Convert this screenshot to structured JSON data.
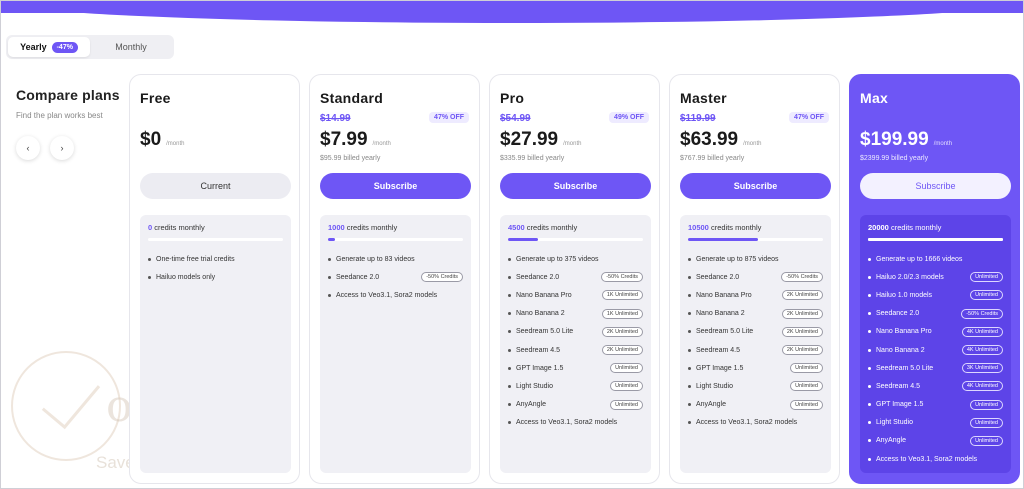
{
  "billing": {
    "yearly_label": "Yearly",
    "yearly_badge": "-47%",
    "monthly_label": "Monthly"
  },
  "side": {
    "title": "Compare plans",
    "subtitle": "Find the plan works best",
    "prev_glyph": "‹",
    "next_glyph": "›"
  },
  "watermark": {
    "brand": "oupon",
    "slogan": "Save time - Save money"
  },
  "colors": {
    "accent": "#6e56f5",
    "muted_bg": "#f0f0f5"
  },
  "plans": [
    {
      "name": "Free",
      "old_price": "",
      "discount": "",
      "price": "$0",
      "per": "/month",
      "billed": "",
      "cta": "Current",
      "credits_value": "0",
      "credits_label": "credits monthly",
      "credits_fill": 0,
      "features": [
        {
          "label": "One-time free trial credits",
          "tag": ""
        },
        {
          "label": "Hailuo models only",
          "tag": ""
        }
      ]
    },
    {
      "name": "Standard",
      "old_price": "$14.99",
      "discount": "47% OFF",
      "price": "$7.99",
      "per": "/month",
      "billed": "$95.99 billed yearly",
      "cta": "Subscribe",
      "credits_value": "1000",
      "credits_label": "credits monthly",
      "credits_fill": 0.05,
      "features": [
        {
          "label": "Generate up to 83 videos",
          "tag": ""
        },
        {
          "label": "Seedance 2.0",
          "tag": "-50% Credits"
        },
        {
          "label": "Access to Veo3.1, Sora2 models",
          "tag": ""
        }
      ]
    },
    {
      "name": "Pro",
      "old_price": "$54.99",
      "discount": "49% OFF",
      "price": "$27.99",
      "per": "/month",
      "billed": "$335.99 billed yearly",
      "cta": "Subscribe",
      "credits_value": "4500",
      "credits_label": "credits monthly",
      "credits_fill": 0.22,
      "features": [
        {
          "label": "Generate up to 375 videos",
          "tag": ""
        },
        {
          "label": "Seedance 2.0",
          "tag": "-50% Credits"
        },
        {
          "label": "Nano Banana Pro",
          "tag": "1K Unlimited"
        },
        {
          "label": "Nano Banana 2",
          "tag": "1K Unlimited"
        },
        {
          "label": "Seedream 5.0 Lite",
          "tag": "2K Unlimited"
        },
        {
          "label": "Seedream 4.5",
          "tag": "2K Unlimited"
        },
        {
          "label": "GPT Image 1.5",
          "tag": "Unlimited"
        },
        {
          "label": "Light Studio",
          "tag": "Unlimited"
        },
        {
          "label": "AnyAngle",
          "tag": "Unlimited"
        },
        {
          "label": "Access to Veo3.1, Sora2 models",
          "tag": ""
        }
      ]
    },
    {
      "name": "Master",
      "old_price": "$119.99",
      "discount": "47% OFF",
      "price": "$63.99",
      "per": "/month",
      "billed": "$767.99 billed yearly",
      "cta": "Subscribe",
      "credits_value": "10500",
      "credits_label": "credits monthly",
      "credits_fill": 0.52,
      "features": [
        {
          "label": "Generate up to 875 videos",
          "tag": ""
        },
        {
          "label": "Seedance 2.0",
          "tag": "-50% Credits"
        },
        {
          "label": "Nano Banana Pro",
          "tag": "2K Unlimited"
        },
        {
          "label": "Nano Banana 2",
          "tag": "2K Unlimited"
        },
        {
          "label": "Seedream 5.0 Lite",
          "tag": "2K Unlimited"
        },
        {
          "label": "Seedream 4.5",
          "tag": "2K Unlimited"
        },
        {
          "label": "GPT Image 1.5",
          "tag": "Unlimited"
        },
        {
          "label": "Light Studio",
          "tag": "Unlimited"
        },
        {
          "label": "AnyAngle",
          "tag": "Unlimited"
        },
        {
          "label": "Access to Veo3.1, Sora2 models",
          "tag": ""
        }
      ]
    },
    {
      "name": "Max",
      "old_price": "",
      "discount": "",
      "price": "$199.99",
      "per": "/month",
      "billed": "$2399.99 billed yearly",
      "cta": "Subscribe",
      "credits_value": "20000",
      "credits_label": "credits monthly",
      "credits_fill": 1.0,
      "features": [
        {
          "label": "Generate up to 1666 videos",
          "tag": ""
        },
        {
          "label": "Hailuo 2.0/2.3 models",
          "tag": "Unlimited"
        },
        {
          "label": "Hailuo 1.0 models",
          "tag": "Unlimited"
        },
        {
          "label": "Seedance 2.0",
          "tag": "-50% Credits"
        },
        {
          "label": "Nano Banana Pro",
          "tag": "4K Unlimited"
        },
        {
          "label": "Nano Banana 2",
          "tag": "4K Unlimited"
        },
        {
          "label": "Seedream 5.0 Lite",
          "tag": "3K Unlimited"
        },
        {
          "label": "Seedream 4.5",
          "tag": "4K Unlimited"
        },
        {
          "label": "GPT Image 1.5",
          "tag": "Unlimited"
        },
        {
          "label": "Light Studio",
          "tag": "Unlimited"
        },
        {
          "label": "AnyAngle",
          "tag": "Unlimited"
        },
        {
          "label": "Access to Veo3.1, Sora2 models",
          "tag": ""
        }
      ]
    }
  ]
}
